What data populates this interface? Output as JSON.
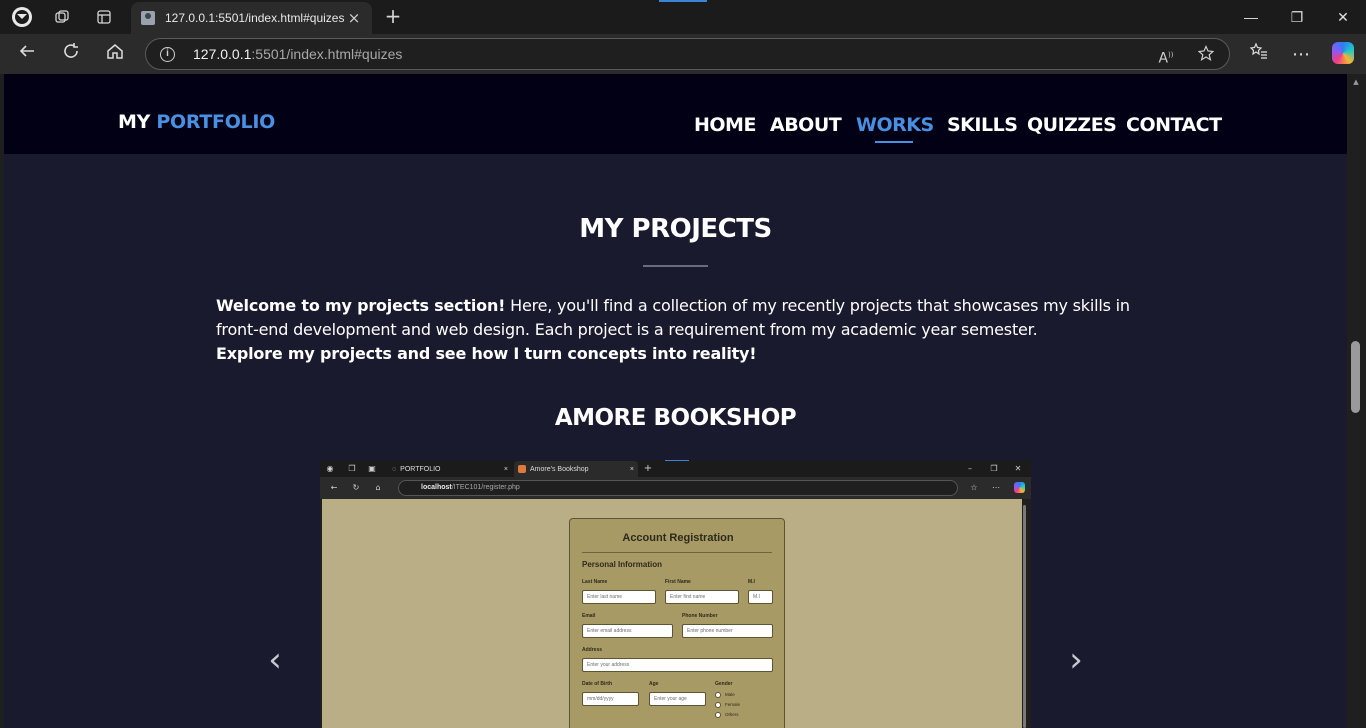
{
  "browser": {
    "tab_title": "127.0.0.1:5501/index.html#quizes",
    "url_host": "127.0.0.1",
    "url_rest": ":5501/index.html#quizes",
    "new_tab": "+",
    "tab_close": "×",
    "window": {
      "minimize": "—",
      "restore": "❐",
      "close": "✕"
    }
  },
  "site": {
    "logo_my": "MY",
    "logo_portfolio": "PORTFOLIO",
    "nav": [
      "HOME",
      "ABOUT",
      "WORKS",
      "SKILLS",
      "QUIZZES",
      "CONTACT"
    ],
    "active_nav": "WORKS"
  },
  "projects": {
    "title": "MY PROJECTS",
    "intro_bold": "Welcome to my projects section!",
    "intro_text": " Here, you'll find a collection of my recently projects that showcases my skills in front-end development and web design. Each project is a requirement from my academic year semester.",
    "intro_cta": "Explore my projects and see how I turn concepts into reality!",
    "project_name": "AMORE BOOKSHOP",
    "prev_arrow": "‹",
    "next_arrow": "›"
  },
  "screenshot": {
    "tab1": "PORTFOLIO",
    "tab2": "Amore's Bookshop",
    "url_host": "localhost",
    "url_rest": "/ITEC101/register.php",
    "form_title": "Account Registration",
    "section": "Personal Information",
    "labels": {
      "last_name": "Last Name",
      "first_name": "First Name",
      "mi": "M.I",
      "email": "Email",
      "phone": "Phone Number",
      "address": "Address",
      "dob": "Date of Birth",
      "age": "Age",
      "gender": "Gender"
    },
    "placeholders": {
      "last_name": "Enter last name",
      "first_name": "Enter first name",
      "mi": "M.I",
      "email": "Enter email address",
      "phone": "Enter phone number",
      "address": "Enter your address",
      "dob": "mm/dd/yyyy",
      "age": "Enter your age"
    },
    "gender_options": [
      "Male",
      "Female",
      "Others"
    ]
  },
  "colors": {
    "accent": "#4a90e2",
    "header_bg": "#010015",
    "page_bg": "#1a1a2e"
  }
}
